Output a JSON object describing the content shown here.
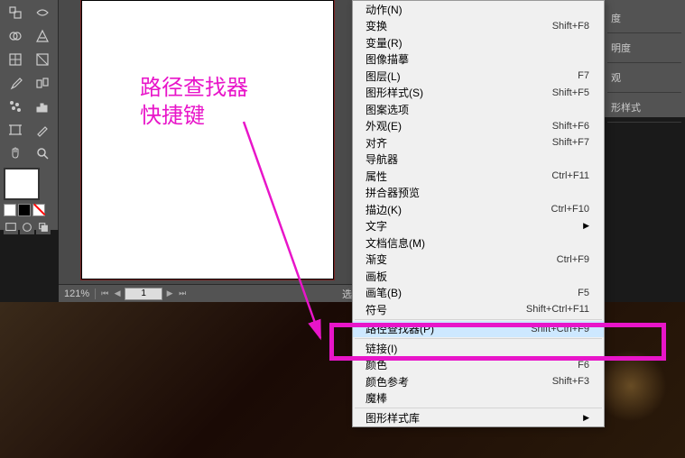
{
  "annotation": {
    "line1": "路径查找器",
    "line2": "快捷键"
  },
  "zoom": "121%",
  "page_number": "1",
  "status_text": "选择",
  "right_panel": {
    "item1": "度",
    "item2": "明度",
    "item3": "观",
    "item4": "形样式"
  },
  "menu_items": [
    {
      "label": "动作(N)",
      "shortcut": "",
      "arrow": false,
      "sep": false
    },
    {
      "label": "变换",
      "shortcut": "Shift+F8",
      "arrow": false,
      "sep": false
    },
    {
      "label": "变量(R)",
      "shortcut": "",
      "arrow": false,
      "sep": false
    },
    {
      "label": "图像描摹",
      "shortcut": "",
      "arrow": false,
      "sep": false
    },
    {
      "label": "图层(L)",
      "shortcut": "F7",
      "arrow": false,
      "sep": false
    },
    {
      "label": "图形样式(S)",
      "shortcut": "Shift+F5",
      "arrow": false,
      "sep": false
    },
    {
      "label": "图案选项",
      "shortcut": "",
      "arrow": false,
      "sep": false
    },
    {
      "label": "外观(E)",
      "shortcut": "Shift+F6",
      "arrow": false,
      "sep": false
    },
    {
      "label": "对齐",
      "shortcut": "Shift+F7",
      "arrow": false,
      "sep": false
    },
    {
      "label": "导航器",
      "shortcut": "",
      "arrow": false,
      "sep": false
    },
    {
      "label": "属性",
      "shortcut": "Ctrl+F11",
      "arrow": false,
      "sep": false
    },
    {
      "label": "拼合器预览",
      "shortcut": "",
      "arrow": false,
      "sep": false
    },
    {
      "label": "描边(K)",
      "shortcut": "Ctrl+F10",
      "arrow": false,
      "sep": false
    },
    {
      "label": "文字",
      "shortcut": "",
      "arrow": true,
      "sep": false
    },
    {
      "label": "文档信息(M)",
      "shortcut": "",
      "arrow": false,
      "sep": false
    },
    {
      "label": "渐变",
      "shortcut": "Ctrl+F9",
      "arrow": false,
      "sep": false
    },
    {
      "label": "画板",
      "shortcut": "",
      "arrow": false,
      "sep": false
    },
    {
      "label": "画笔(B)",
      "shortcut": "F5",
      "arrow": false,
      "sep": false
    },
    {
      "label": "符号",
      "shortcut": "Shift+Ctrl+F11",
      "arrow": false,
      "sep": false
    },
    {
      "sep": true
    },
    {
      "label": "路径查找器(P)",
      "shortcut": "Shift+Ctrl+F9",
      "arrow": false,
      "sep": false,
      "highlight": true
    },
    {
      "sep": true
    },
    {
      "label": "链接(I)",
      "shortcut": "",
      "arrow": false,
      "sep": false
    },
    {
      "label": "颜色",
      "shortcut": "F6",
      "arrow": false,
      "sep": false
    },
    {
      "label": "颜色参考",
      "shortcut": "Shift+F3",
      "arrow": false,
      "sep": false
    },
    {
      "label": "魔棒",
      "shortcut": "",
      "arrow": false,
      "sep": false
    },
    {
      "sep": true
    },
    {
      "label": "图形样式库",
      "shortcut": "",
      "arrow": true,
      "sep": false
    }
  ]
}
